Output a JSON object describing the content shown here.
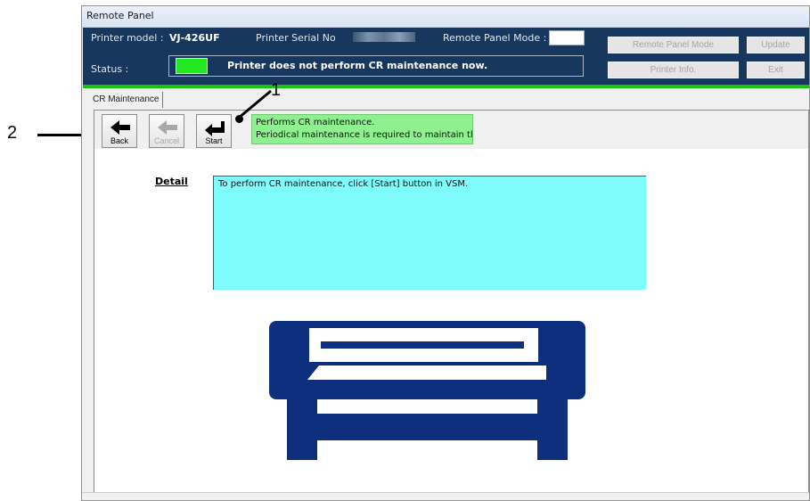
{
  "window": {
    "title": "Remote Panel"
  },
  "header": {
    "printer_model_label": "Printer model :",
    "printer_model_value": "VJ-426UF",
    "serial_label": "Printer Serial No",
    "mode_label": "Remote Panel Mode :",
    "status_label": "Status :",
    "status_message": "Printer does not perform CR maintenance now.",
    "status_led_color": "#22e822",
    "buttons": {
      "remote_panel_mode": "Remote Panel Mode",
      "update": "Update",
      "printer_info": "Printer Info.",
      "exit": "Exit"
    }
  },
  "tab": {
    "label": "CR Maintenance"
  },
  "toolbar": {
    "back_label": "Back",
    "cancel_label": "Cancel",
    "start_label": "Start",
    "description_line1": "Performs CR maintenance.",
    "description_line2": "Periodical maintenance is required to maintain the"
  },
  "detail": {
    "label": "Detail",
    "text": "To perform CR maintenance, click [Start] button in VSM."
  },
  "callouts": {
    "one": "1",
    "two": "2"
  },
  "colors": {
    "header_bg": "#17375e",
    "accent_green": "#16c60c",
    "description_bg": "#8ef08e",
    "detail_bg": "#7ffcfc",
    "printer_illustration": "#0d2f7e"
  },
  "icons": {
    "back": "arrow-left-icon",
    "cancel": "arrow-left-disabled-icon",
    "start": "enter-return-icon",
    "illustration": "printer-illustration"
  }
}
